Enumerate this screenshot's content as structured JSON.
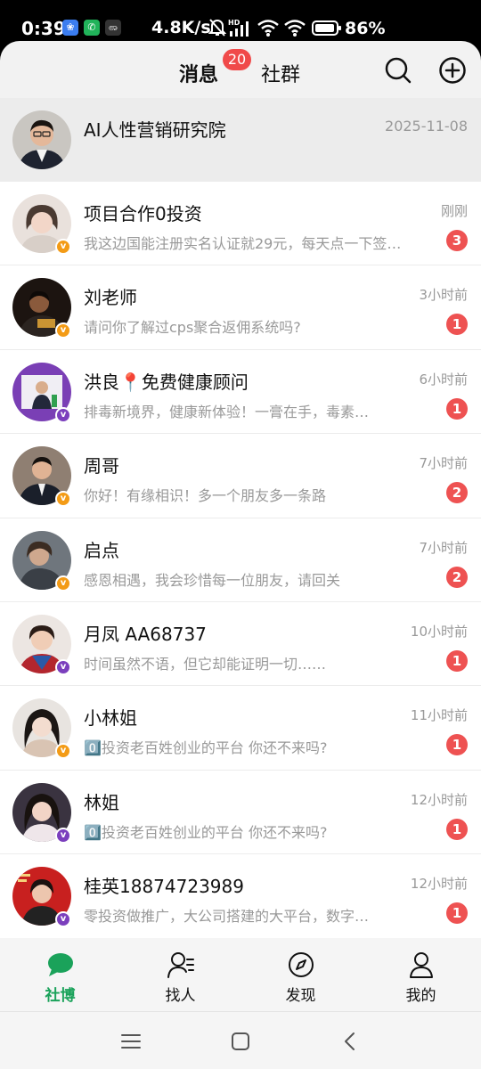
{
  "status_bar": {
    "time": "0:39",
    "net_speed": "4.8K/s",
    "battery": "86%",
    "icons": [
      "paw-app-icon",
      "phone-app-icon",
      "app-icon",
      "mute-bell-icon",
      "hd-signal-icon",
      "wifi-icon",
      "wifi-icon",
      "battery-icon"
    ]
  },
  "header": {
    "tabs": [
      {
        "label": "消息",
        "badge": "20"
      },
      {
        "label": "社群"
      }
    ],
    "search_icon": "search-icon",
    "add_icon": "add-circle-icon"
  },
  "pinned": {
    "name": "AI人性营销研究院",
    "time": "2025-11-08"
  },
  "conversations": [
    {
      "name": "项目合作0投资",
      "preview": "我这边国能注册实名认证就29元，每天点一下签…",
      "time": "刚刚",
      "unread": "3",
      "badge_color": "orange"
    },
    {
      "name": "刘老师",
      "preview": "请问你了解过cps聚合返佣系统吗?",
      "time": "3小时前",
      "unread": "1",
      "badge_color": "orange"
    },
    {
      "name": "洪良📍免费健康顾问",
      "preview": " 排毒新境界，健康新体验！一膏在手，毒素…",
      "time": "6小时前",
      "unread": "1",
      "badge_color": "purple"
    },
    {
      "name": "周哥",
      "preview": "你好！有缘相识！多一个朋友多一条路",
      "time": "7小时前",
      "unread": "2",
      "badge_color": "orange"
    },
    {
      "name": "启点",
      "preview": "感恩相遇，我会珍惜每一位朋友，请回关",
      "time": "7小时前",
      "unread": "2",
      "badge_color": "orange"
    },
    {
      "name": "月凤 AA68737",
      "preview": "时间虽然不语，但它却能证明一切……",
      "time": "10小时前",
      "unread": "1",
      "badge_color": "purple"
    },
    {
      "name": "小林姐",
      "preview": "0️⃣投资老百姓创业的平台 你还不来吗?",
      "time": "11小时前",
      "unread": "1",
      "badge_color": "orange"
    },
    {
      "name": "林姐",
      "preview": "0️⃣投资老百姓创业的平台 你还不来吗?",
      "time": "12小时前",
      "unread": "1",
      "badge_color": "purple"
    },
    {
      "name": "桂英18874723989",
      "preview": "零投资做推广，大公司搭建的大平台，数字…",
      "time": "12小时前",
      "unread": "1",
      "badge_color": "purple"
    }
  ],
  "bottom_nav": [
    {
      "label": "社博",
      "icon": "chat-bubble-icon",
      "active": true
    },
    {
      "label": "找人",
      "icon": "find-people-icon"
    },
    {
      "label": "发现",
      "icon": "compass-icon"
    },
    {
      "label": "我的",
      "icon": "person-icon"
    }
  ],
  "system_nav": [
    "menu-icon",
    "home-icon",
    "back-icon"
  ],
  "colors": {
    "accent_green": "#1aa25a",
    "badge_red": "#ee5252",
    "vip_orange": "#f39b16",
    "vip_purple": "#7b3fbd"
  }
}
